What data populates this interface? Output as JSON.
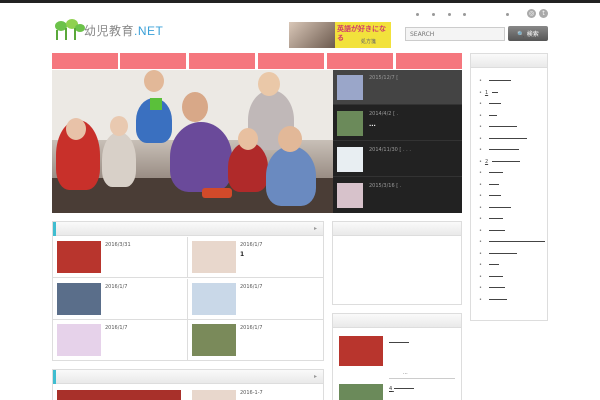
{
  "site": {
    "name": "幼児教育.NET",
    "name_main": "幼児教育",
    "name_tld": ".NET"
  },
  "banner": {
    "headline": "英語が好きになる",
    "sub": "処方箋"
  },
  "search": {
    "placeholder": "SEARCH",
    "button_label": "検索"
  },
  "slider": {
    "thumbs": [
      {
        "date": "2015/12/7",
        "title": "",
        "color": "#9aa6c9"
      },
      {
        "date": "2014/4/2",
        "title": "...",
        "color": "#6b8a5a"
      },
      {
        "date": "2014/11/30",
        "title": "",
        "color": "#e8eef2"
      },
      {
        "date": "2015/3/16",
        "title": "",
        "color": "#d7c2cb"
      }
    ],
    "thumb_suffixes": [
      "[",
      "[   .",
      "[   . . .",
      "[   ."
    ]
  },
  "posts": [
    {
      "date": "2016/3/31",
      "title": "",
      "color": "#b8352d"
    },
    {
      "date": "2016/1/7",
      "title": "1",
      "color": "#e8d7cc"
    },
    {
      "date": "2016/1/7",
      "title": "",
      "color": "#5a6e8a"
    },
    {
      "date": "2016/1/7",
      "title": "",
      "color": "#c9d8e8"
    },
    {
      "date": "2016/1/7",
      "title": "",
      "color": "#e6d2ea"
    },
    {
      "date": "2016/1/7",
      "title": "",
      "color": "#7a8a5a"
    }
  ],
  "section2": {
    "date": "2016-1-7"
  },
  "sidebar_widget": {
    "items": [
      {
        "title": "",
        "meta": "",
        "color": "#b8352d"
      },
      {
        "title": "4",
        "meta": "",
        "color": "#6b8a5a"
      }
    ],
    "item_meta": "..."
  },
  "sidebar_list": [
    {
      "label": "",
      "w": 22
    },
    {
      "label": "1",
      "w": 6
    },
    {
      "label": "",
      "w": 12
    },
    {
      "label": "",
      "w": 8
    },
    {
      "label": "",
      "w": 28
    },
    {
      "label": "",
      "w": 38
    },
    {
      "label": "",
      "w": 30
    },
    {
      "label": "2",
      "w": 28
    },
    {
      "label": "",
      "w": 14
    },
    {
      "label": "",
      "w": 10
    },
    {
      "label": "",
      "w": 12
    },
    {
      "label": "",
      "w": 22
    },
    {
      "label": "",
      "w": 14
    },
    {
      "label": "",
      "w": 16
    },
    {
      "label": "",
      "w": 56
    },
    {
      "label": "",
      "w": 28
    },
    {
      "label": "",
      "w": 10
    },
    {
      "label": "",
      "w": 14
    },
    {
      "label": "",
      "w": 16
    },
    {
      "label": "",
      "w": 18
    }
  ],
  "colors": {
    "nav": "#f5777e",
    "accent": "#3fbdd0",
    "dark": "#222222"
  }
}
